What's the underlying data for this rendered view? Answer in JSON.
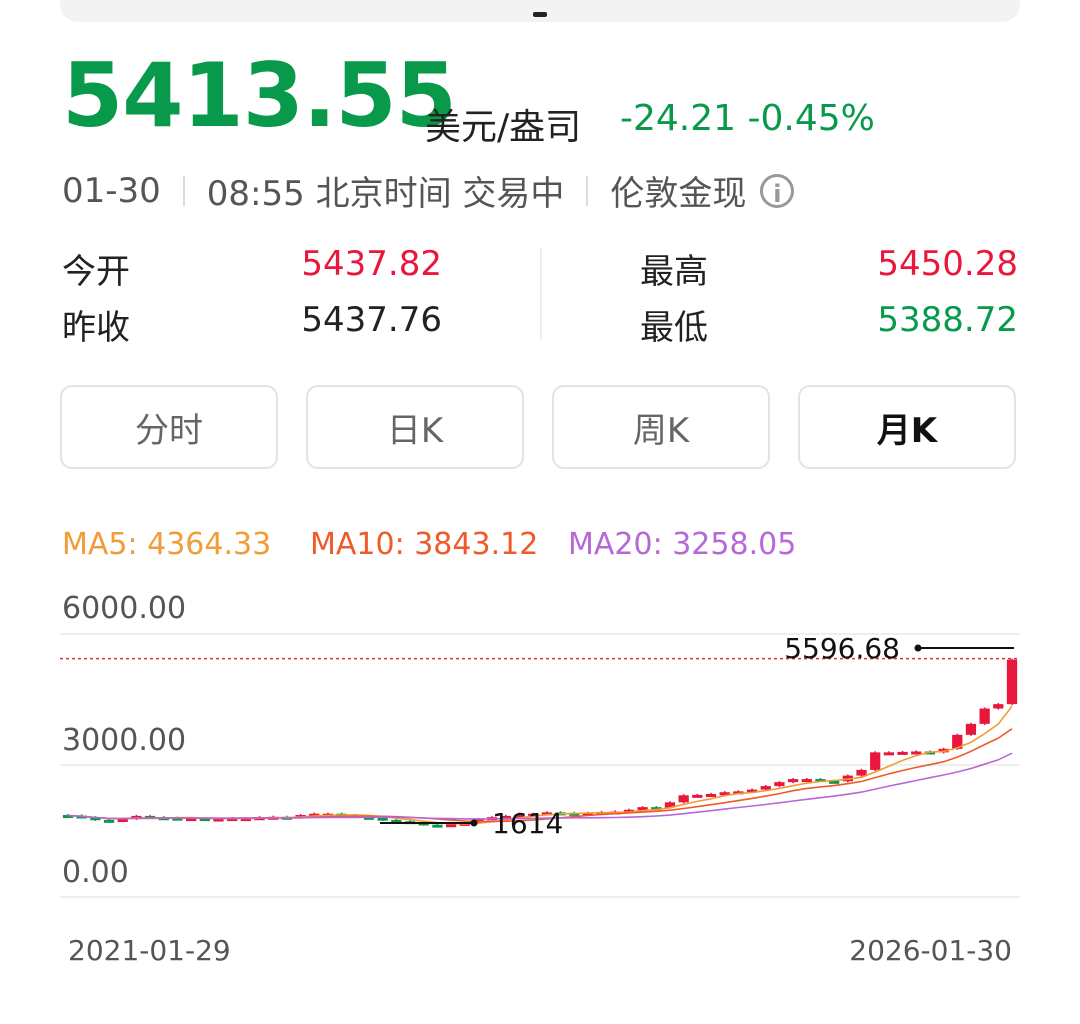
{
  "quote": {
    "price": "5413.55",
    "unit": "美元/盎司",
    "change": "-24.21 -0.45%",
    "date": "01-30",
    "time_status": "08:55 北京时间 交易中",
    "market": "伦敦金现"
  },
  "stats": {
    "open_label": "今开",
    "open_value": "5437.82",
    "prev_label": "昨收",
    "prev_value": "5437.76",
    "high_label": "最高",
    "high_value": "5450.28",
    "low_label": "最低",
    "low_value": "5388.72"
  },
  "tabs": [
    "分时",
    "日K",
    "周K",
    "月K"
  ],
  "active_tab": "月K",
  "ma": {
    "ma5": "MA5: 4364.33",
    "ma10": "MA10: 3843.12",
    "ma20": "MA20: 3258.05"
  },
  "colors": {
    "up": "#e8173b",
    "down": "#089a4a",
    "ma5": "#f39b36",
    "ma10": "#ee5a2a",
    "ma20": "#b768d8"
  },
  "icons": {
    "info": "info-circle-icon"
  },
  "chart_data": {
    "type": "candlestick",
    "y_tick_labels": [
      "6000.00",
      "3000.00",
      "0.00"
    ],
    "x_tick_labels": [
      "2021-01-29",
      "2026-01-30"
    ],
    "ylim": [
      0,
      6000
    ],
    "high_marker": "5596.68",
    "low_marker": "1614",
    "reference_line": 5437.76,
    "grid": true,
    "closes": [
      1860,
      1820,
      1760,
      1730,
      1780,
      1850,
      1820,
      1810,
      1790,
      1800,
      1780,
      1790,
      1800,
      1800,
      1820,
      1830,
      1810,
      1870,
      1900,
      1900,
      1870,
      1830,
      1810,
      1760,
      1730,
      1700,
      1650,
      1640,
      1660,
      1690,
      1780,
      1820,
      1850,
      1880,
      1900,
      1930,
      1920,
      1900,
      1920,
      1940,
      1950,
      1990,
      2050,
      2040,
      2160,
      2320,
      2330,
      2350,
      2390,
      2410,
      2450,
      2530,
      2620,
      2690,
      2690,
      2650,
      2640,
      2770,
      2900,
      3300,
      3300,
      3310,
      3320,
      3300,
      3380,
      3700,
      3950,
      4300,
      4400,
      5413.55
    ]
  }
}
